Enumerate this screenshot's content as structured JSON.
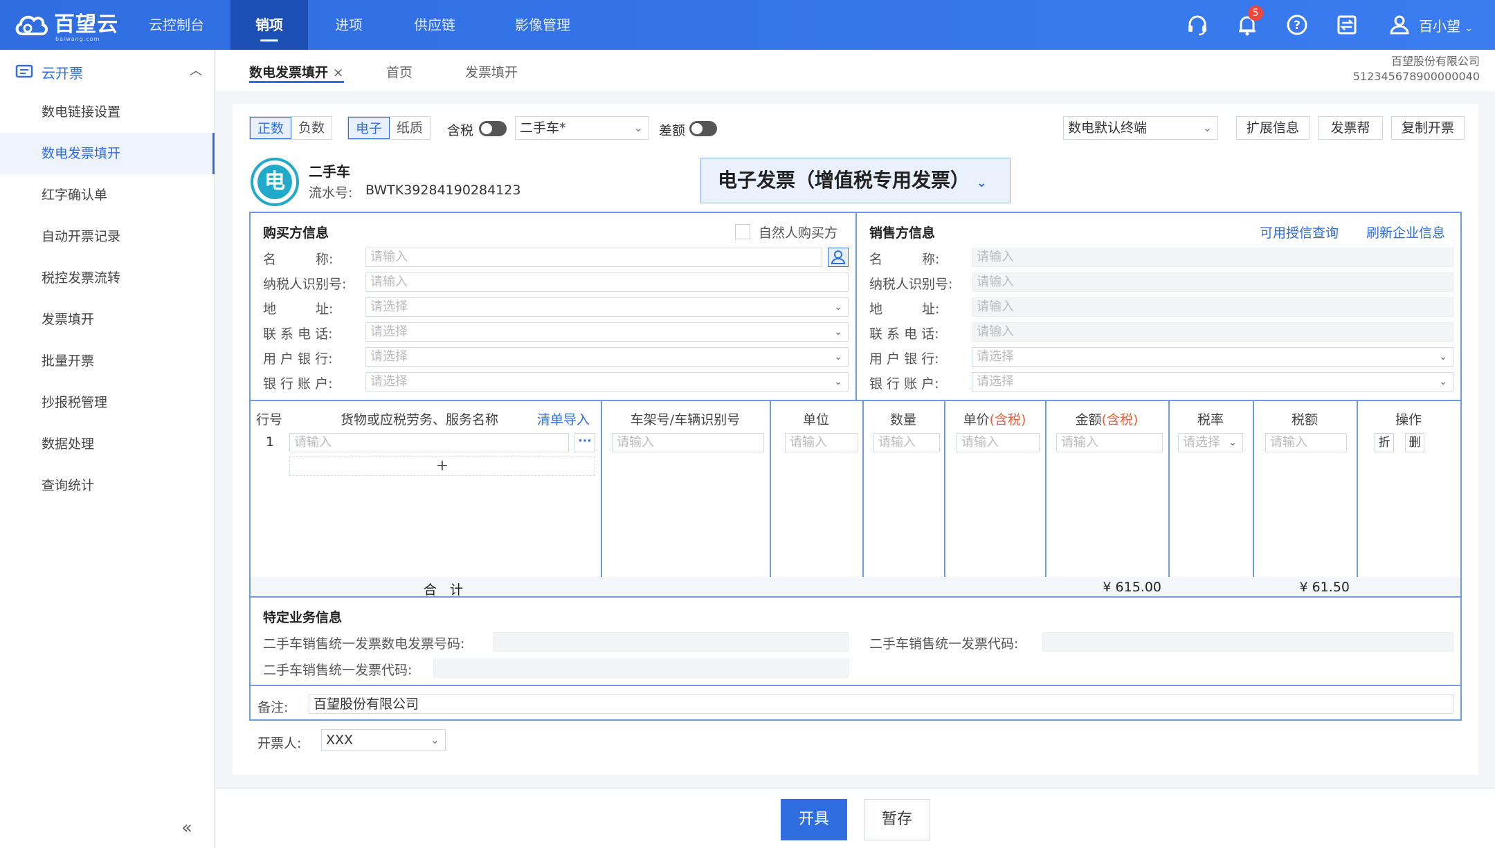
{
  "brand": {
    "name": "百望云",
    "sub": "baiwang.com"
  },
  "topnav": [
    "云控制台",
    "销项",
    "进项",
    "供应链",
    "影像管理"
  ],
  "notifications": "5",
  "user": "百小望",
  "sidebar": {
    "header": "云开票",
    "items": [
      "数电链接设置",
      "数电发票填开",
      "红字确认单",
      "自动开票记录",
      "税控发票流转",
      "发票填开",
      "批量开票",
      "抄报税管理",
      "数据处理",
      "查询统计"
    ]
  },
  "tabs": [
    "数电发票填开",
    "首页",
    "发票填开"
  ],
  "company": {
    "name": "百望股份有限公司",
    "tax_id": "512345678900000040"
  },
  "toolbar": {
    "positive": "正数",
    "negative": "负数",
    "electronic": "电子",
    "paper": "纸质",
    "tax_incl": "含税",
    "category": "二手车*",
    "diff": "差额",
    "terminal": "数电默认终端",
    "extend": "扩展信息",
    "help": "发票帮",
    "copy": "复制开票"
  },
  "invoice": {
    "badge": "电",
    "type": "二手车",
    "serial_label": "流水号:",
    "serial": "BWTK39284190284123",
    "title": "电子发票（增值税专用发票）"
  },
  "buyer": {
    "title": "购买方信息",
    "natural": "自然人购买方",
    "fields": [
      {
        "label": "名　　　称:",
        "placeholder": "请输入"
      },
      {
        "label": "纳税人识别号:",
        "placeholder": "请输入"
      },
      {
        "label": "地　　　址:",
        "placeholder": "请选择"
      },
      {
        "label": "联 系 电 话:",
        "placeholder": "请选择"
      },
      {
        "label": "用 户 银 行:",
        "placeholder": "请选择"
      },
      {
        "label": "银 行 账 户:",
        "placeholder": "请选择"
      }
    ]
  },
  "seller": {
    "title": "销售方信息",
    "credit": "可用授信查询",
    "refresh": "刷新企业信息",
    "fields": [
      {
        "label": "名　　　称:",
        "placeholder": "请输入"
      },
      {
        "label": "纳税人识别号:",
        "placeholder": "请输入"
      },
      {
        "label": "地　　　址:",
        "placeholder": "请输入"
      },
      {
        "label": "联 系 电 话:",
        "placeholder": "请输入"
      },
      {
        "label": "用 户 银 行:",
        "placeholder": "请选择"
      },
      {
        "label": "银 行 账 户:",
        "placeholder": "请选择"
      }
    ]
  },
  "items_table": {
    "headers": {
      "row": "行号",
      "name": "货物或应税劳务、服务名称",
      "import": "清单导入",
      "vin": "车架号/车辆识别号",
      "unit": "单位",
      "qty": "数量",
      "price": "单价",
      "amount": "金额",
      "incl": "(含税)",
      "rate": "税率",
      "tax": "税额",
      "ops": "操作"
    },
    "row_no": "1",
    "placeholder": "请输入",
    "rate_placeholder": "请选择",
    "discount": "折",
    "delete": "删",
    "add": "+",
    "total_label": "合　计",
    "total_amount": "¥ 615.00",
    "total_tax": "¥ 61.50"
  },
  "special": {
    "title": "特定业务信息",
    "field1": "二手车销售统一发票数电发票号码:",
    "field2": "二手车销售统一发票代码:",
    "field3": "二手车销售统一发票代码:"
  },
  "remark": {
    "label": "备注:",
    "value": "百望股份有限公司"
  },
  "issuer": {
    "label": "开票人:",
    "value": "XXX"
  },
  "actions": {
    "submit": "开具",
    "save": "暂存"
  }
}
